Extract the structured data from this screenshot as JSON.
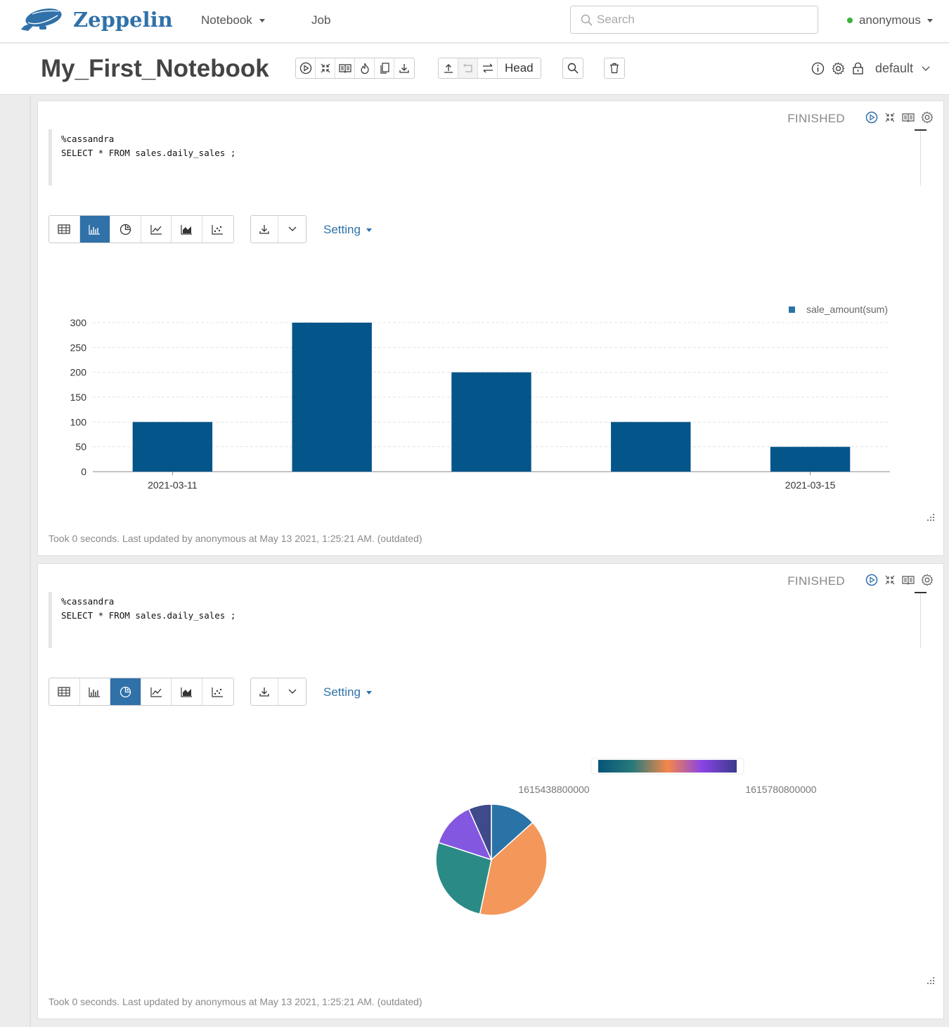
{
  "navbar": {
    "brand": "Zeppelin",
    "notebook_menu": "Notebook",
    "job_link": "Job",
    "search_placeholder": "Search",
    "user": "anonymous"
  },
  "header": {
    "title": "My_First_Notebook",
    "head_label": "Head",
    "interpreter": "default"
  },
  "paragraphs": [
    {
      "status": "FINISHED",
      "code_line1": "%cassandra",
      "code_line2": "SELECT * FROM sales.daily_sales ;",
      "setting_label": "Setting",
      "footer": "Took 0 seconds. Last updated by anonymous at May 13 2021, 1:25:21 AM. (outdated)"
    },
    {
      "status": "FINISHED",
      "code_line1": "%cassandra",
      "code_line2": "SELECT * FROM sales.daily_sales ;",
      "setting_label": "Setting",
      "footer": "Took 0 seconds. Last updated by anonymous at May 13 2021, 1:25:21 AM. (outdated)"
    }
  ],
  "chart_data": [
    {
      "type": "bar",
      "categories": [
        "2021-03-11",
        "",
        "",
        "",
        "2021-03-15"
      ],
      "tick_labels": [
        "2021-03-11",
        "2021-03-15"
      ],
      "series": [
        {
          "name": "sale_amount(sum)",
          "values": [
            100,
            300,
            200,
            100,
            50
          ],
          "color": "#04558a"
        }
      ],
      "yticks": [
        0,
        50,
        100,
        150,
        200,
        250,
        300
      ],
      "ylim": [
        0,
        300
      ],
      "grid": true,
      "legend": "top-right"
    },
    {
      "type": "pie",
      "values": [
        100,
        300,
        200,
        100,
        50
      ],
      "colors": [
        "#2a73a6",
        "#f4975a",
        "#2a8a85",
        "#8457e0",
        "#3e4a89"
      ],
      "colorscale": [
        "#05557a",
        "#2a7a7a",
        "#f4874a",
        "#8a44e6",
        "#3b3b8a"
      ],
      "colorscale_min_label": "1615438800000",
      "colorscale_max_label": "1615780800000"
    }
  ]
}
